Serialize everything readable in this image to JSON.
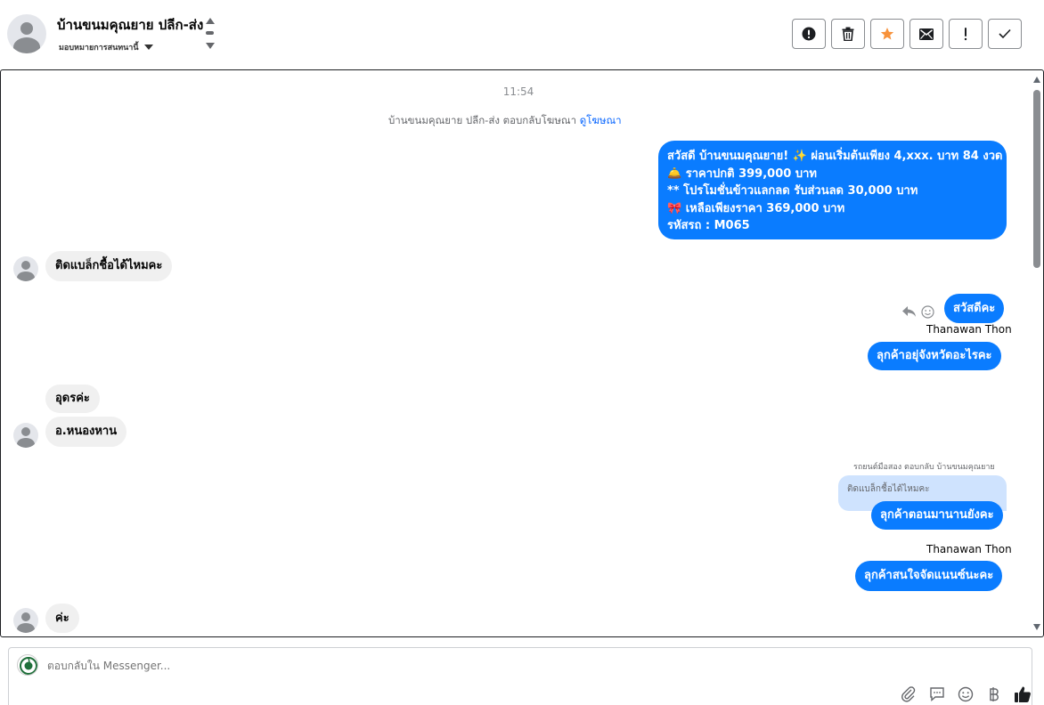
{
  "header": {
    "contact_name": "บ้านขนมคุณยาย ปลีก-ส่ง",
    "assign_label": "มอบหมายการสนทนานี้"
  },
  "toolbar": {
    "buttons": [
      "spam-report",
      "delete",
      "star",
      "mark-unread",
      "important",
      "done"
    ],
    "star_color": "#f7923b"
  },
  "conversation": {
    "timestamp": "11:54",
    "ad_reply_text": "บ้านขนมคุณยาย ปลีก-ส่ง ตอบกลับโฆษณา",
    "ad_reply_link": "ดูโฆษณา",
    "promo_lines": [
      "สวัสดี บ้านขนมคุณยาย! ✨ ผ่อนเริ่มต้นเพียง 4,xxx. บาท 84 งวด",
      "🛎️ ราคาปกติ 399,000 บาท",
      "** โปรโมชั่นข้าวแลกลด รับส่วนลด 30,000 บาท",
      "🎀  เหลือเพียงราคา 369,000 บาท",
      " รหัสรถ : M065"
    ],
    "msg_in_1": "ติดแบล็กชื้อได้ไหมคะ",
    "msg_out_hello": "สวัสดีคะ",
    "sender_name_1": "Thanawan Thon",
    "msg_out_province": "ลุกค้าอยุ่จังหวัดอะไรคะ",
    "msg_in_2": "อุดรค่ะ",
    "msg_in_3": "อ.หนองหาน",
    "reply_context": "รถยนต์มือสอง ตอบกลับ บ้านขนมคุณยาย",
    "quoted_text": "ติดแบล็กชื้อได้ไหมคะ",
    "msg_out_when": "ลุกค้าตอนมานานยังคะ",
    "sender_name_2": "Thanawan Thon",
    "msg_out_finance": "ลุกค้าสนใจจัดแนนซ์นะคะ",
    "msg_in_4": "ค่ะ"
  },
  "composer": {
    "placeholder": "ตอบกลับใน Messenger...",
    "tools": [
      "attach-icon",
      "saved-reply-icon",
      "emoji-icon",
      "baht-icon",
      "thumbs-up-icon"
    ]
  },
  "colors": {
    "outgoing_bubble": "#0a7cff",
    "incoming_bubble": "#f0f0f0",
    "link": "#0866ff"
  }
}
